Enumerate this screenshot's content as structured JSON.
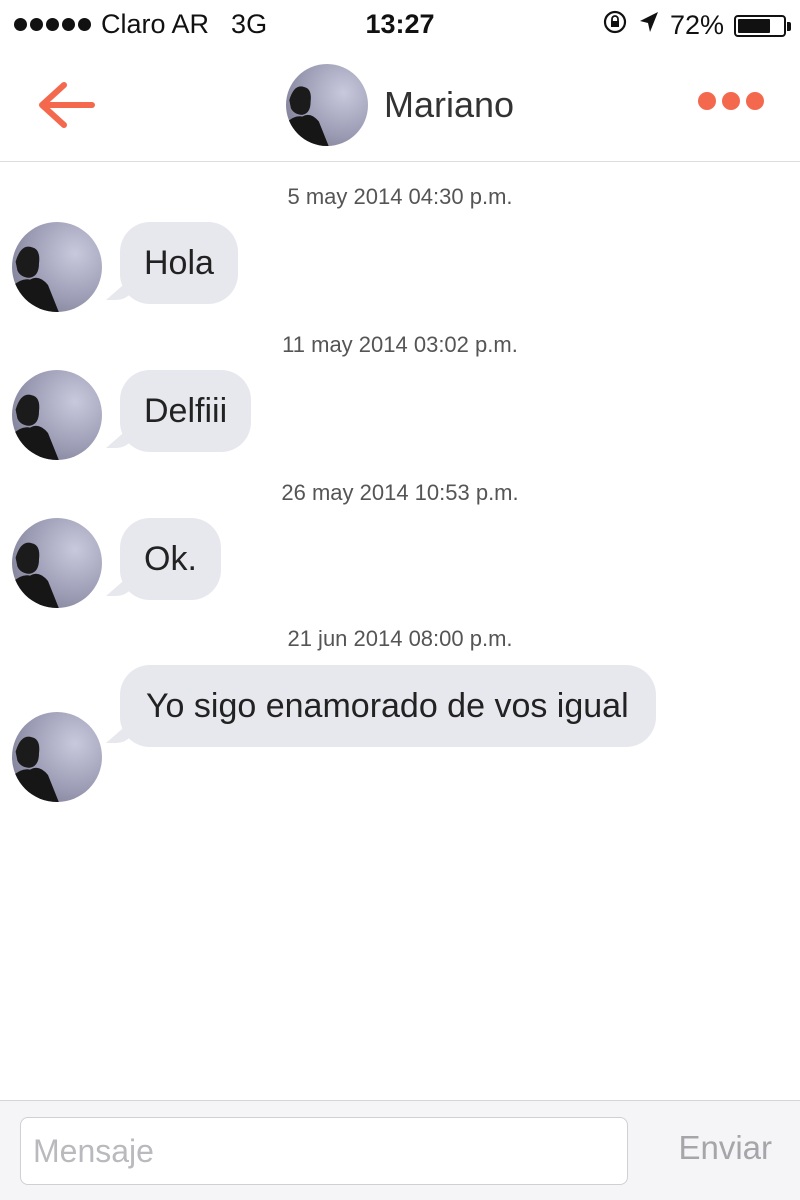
{
  "status_bar": {
    "carrier": "Claro AR",
    "network": "3G",
    "time": "13:27",
    "battery_percent": "72%",
    "battery_level": 0.72,
    "icons": [
      "signal-dots-icon",
      "rotation-lock-icon",
      "location-arrow-icon",
      "battery-icon"
    ]
  },
  "header": {
    "back_icon": "arrow-left-icon",
    "contact_name": "Mariano",
    "more_icon": "more-dots-icon",
    "accent_color": "#f4694d"
  },
  "messages": [
    {
      "timestamp": "5 may 2014 04:30 p.m.",
      "text": "Hola"
    },
    {
      "timestamp": "11 may 2014 03:02 p.m.",
      "text": "Delfiii"
    },
    {
      "timestamp": "26 may 2014 10:53 p.m.",
      "text": "Ok."
    },
    {
      "timestamp": "21 jun 2014 08:00 p.m.",
      "text": "Yo sigo enamorado de vos igual"
    }
  ],
  "input": {
    "placeholder": "Mensaje",
    "value": "",
    "send_label": "Enviar"
  },
  "colors": {
    "bubble_background": "#e7e7ee",
    "accent": "#f4694d"
  }
}
